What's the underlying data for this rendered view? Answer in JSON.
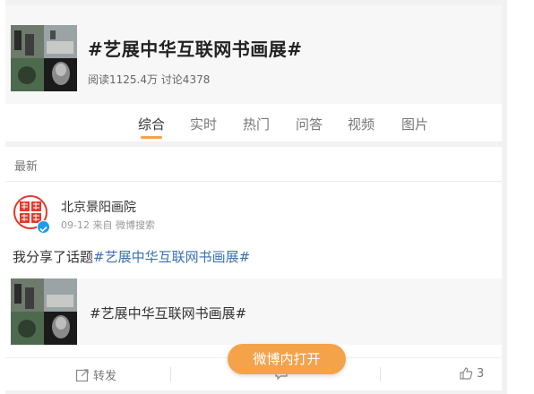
{
  "topic": {
    "title": "#艺展中华互联网书画展#",
    "stats": "阅读1125.4万 讨论4378"
  },
  "tabs": [
    {
      "label": "综合",
      "active": true
    },
    {
      "label": "实时"
    },
    {
      "label": "热门"
    },
    {
      "label": "问答"
    },
    {
      "label": "视频"
    },
    {
      "label": "图片"
    }
  ],
  "section_label": "最新",
  "post": {
    "author": "北京景阳画院",
    "meta": "09-12 来自 微博搜索",
    "text_prefix": "我分享了话题",
    "text_hashtag": "#艺展中华互联网书画展#",
    "share_title": "#艺展中华互联网书画展#"
  },
  "actions": {
    "repost_label": "转发",
    "like_count": "3"
  },
  "open_app_label": "微博内打开",
  "colors": {
    "accent": "#f4a34a",
    "hashtag": "#3b70b0",
    "verified": "#1d9bf0"
  },
  "icons": [
    "repost-icon",
    "comment-icon",
    "like-icon",
    "verified-icon"
  ]
}
